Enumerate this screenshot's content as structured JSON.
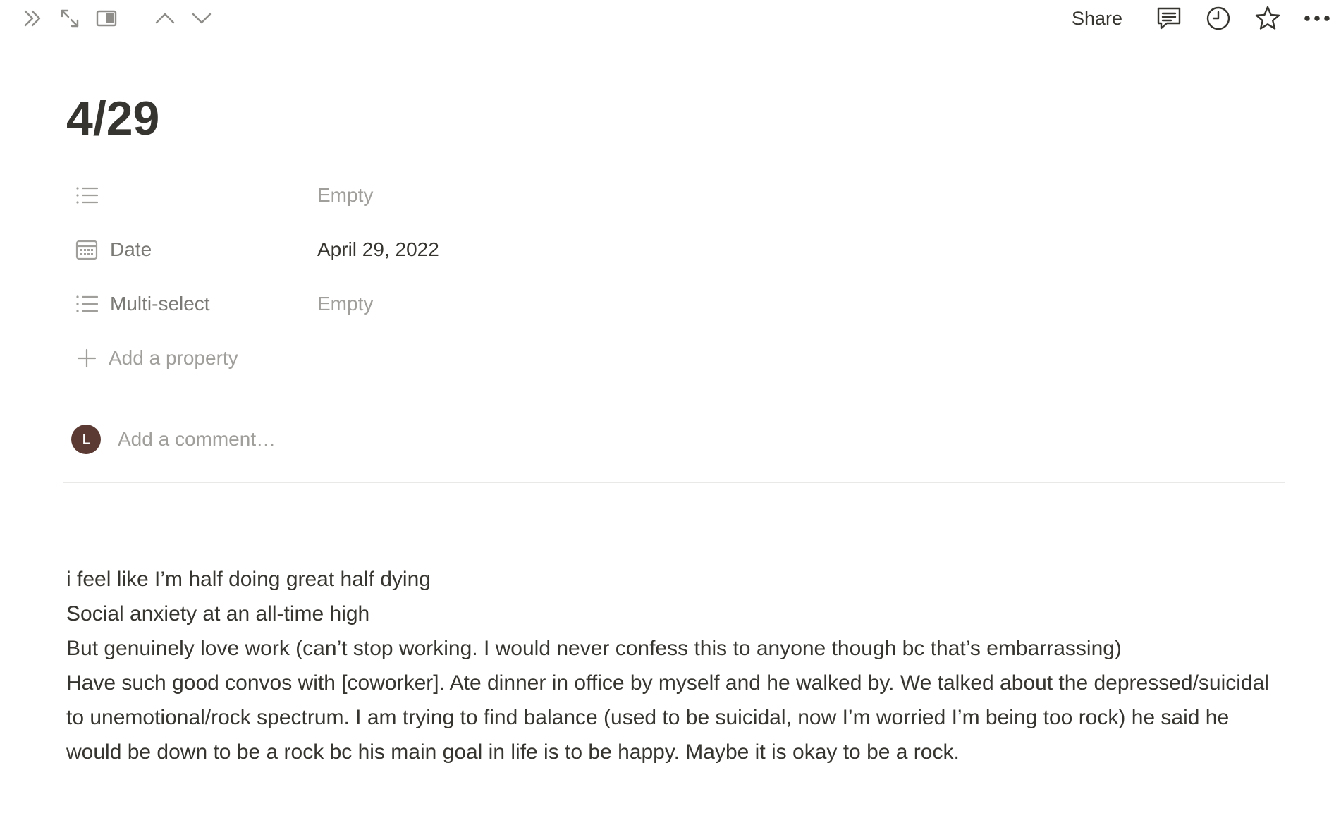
{
  "topbar": {
    "left_icons": [
      "double-chevron-right-icon",
      "expand-icon",
      "side-peek-icon",
      "chevron-up-icon",
      "chevron-down-icon"
    ],
    "share_label": "Share",
    "right_icons": [
      "comment-icon",
      "history-clock-icon",
      "star-icon",
      "more-dots-icon"
    ]
  },
  "page": {
    "title": "4/29",
    "properties": [
      {
        "name": "",
        "icon": "list-icon",
        "value": "Empty",
        "empty": true
      },
      {
        "name": "Date",
        "icon": "calendar-icon",
        "value": "April 29, 2022",
        "empty": false
      },
      {
        "name": "Multi-select",
        "icon": "list-icon",
        "value": "Empty",
        "empty": true
      }
    ],
    "add_property_label": "Add a property",
    "comment": {
      "avatar_initial": "L",
      "placeholder": "Add a comment…"
    },
    "body": [
      "i feel like I’m half doing great half dying",
      "Social anxiety at an all-time high",
      "But genuinely love work (can’t stop working. I would never confess this to anyone though bc that’s embarrassing)",
      "Have such good convos with [coworker]. Ate dinner in office by myself and he walked by. We talked about the depressed/suicidal to unemotional/rock spectrum. I am trying to find balance (used to be suicidal, now I’m worried I’m being too rock) he said he would be down to be a rock bc his main goal in life is to be happy. Maybe it is okay to be a rock."
    ]
  },
  "colors": {
    "text": "#37352f",
    "muted": "#a09f9c",
    "avatar_bg": "#5a3a33",
    "divider": "#e9e9e7"
  }
}
